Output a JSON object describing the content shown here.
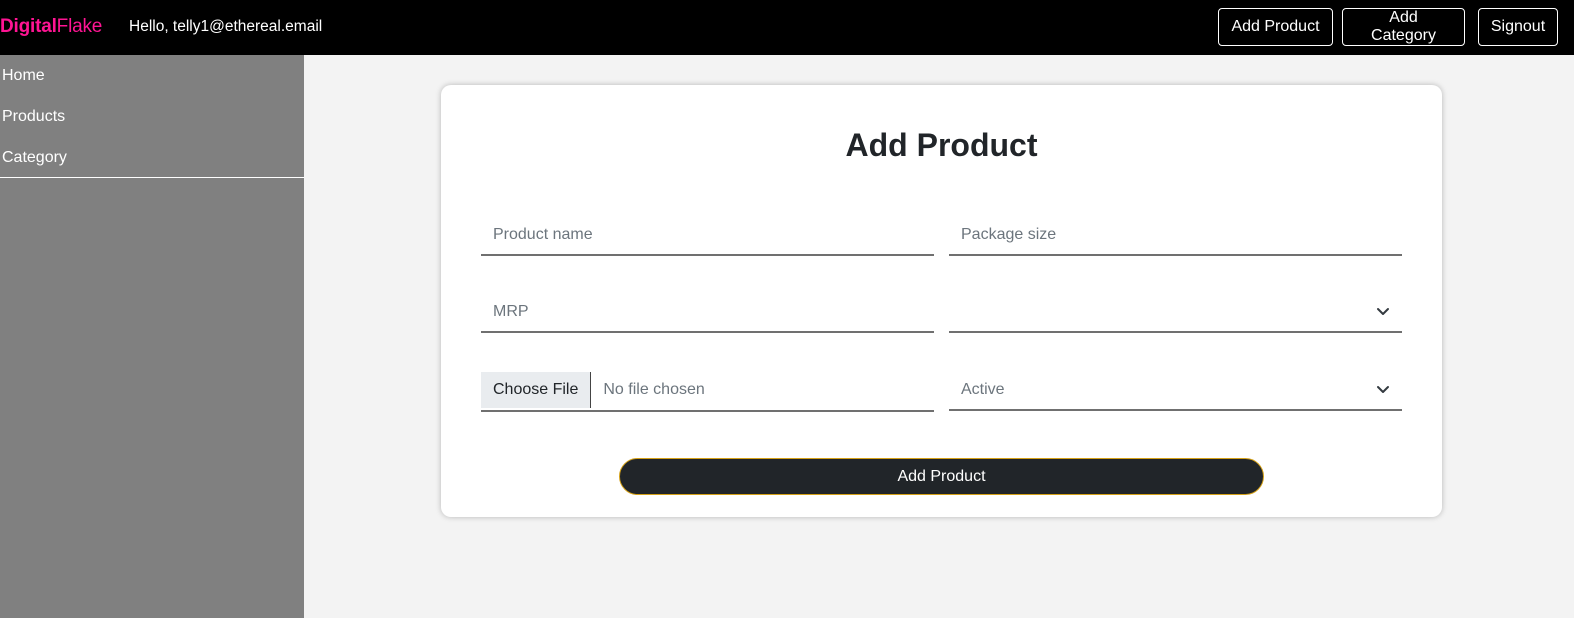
{
  "navbar": {
    "brand_bold": "Digital",
    "brand_rest": "Flake",
    "greeting": "Hello, telly1@ethereal.email",
    "add_product_label": "Add Product",
    "add_category_label": "Add Category",
    "signout_label": "Signout"
  },
  "sidebar": {
    "items": [
      {
        "label": "Home"
      },
      {
        "label": "Products"
      },
      {
        "label": "Category"
      }
    ]
  },
  "form": {
    "title": "Add Product",
    "product_name_placeholder": "Product name",
    "package_size_placeholder": "Package size",
    "mrp_placeholder": "MRP",
    "category_select_value": "",
    "file_button_label": "Choose File",
    "file_status": "No file chosen",
    "status_select_value": "Active",
    "submit_label": "Add Product"
  },
  "colors": {
    "brand": "#ff1493",
    "navbar_bg": "#000000",
    "sidebar_bg": "#808080",
    "page_bg": "#f3f3f3",
    "submit_bg": "#212529",
    "submit_border": "#d4a017"
  },
  "icons": {
    "select_chevron": "chevron-down-icon"
  }
}
